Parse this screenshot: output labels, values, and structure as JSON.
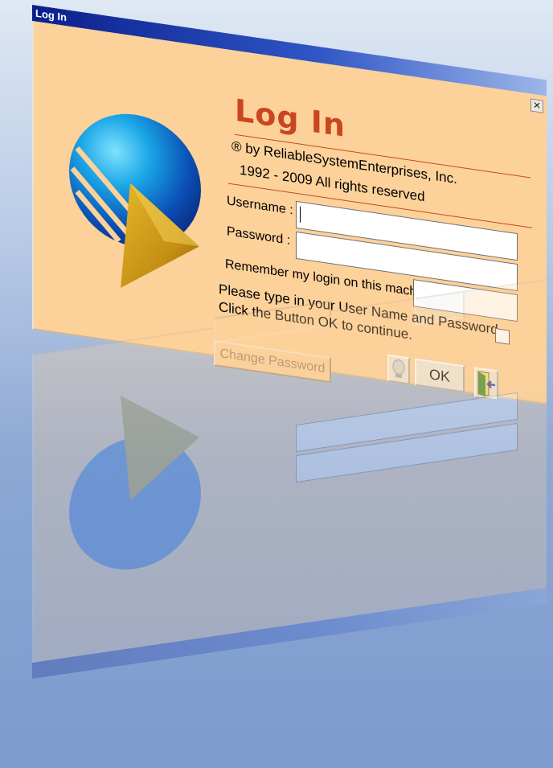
{
  "window": {
    "title": "Log In",
    "close_glyph": "×"
  },
  "dialog": {
    "heading": "Log In",
    "copyright_line1": "® by ReliableSystemEnterprises, Inc.",
    "copyright_line2": "1992 - 2009 All rights reserved",
    "username_label": "Username :",
    "username_value": "",
    "password_label": "Password :",
    "password_value": "",
    "remember_label": "Remember my login on this machine:",
    "remember_checked": false,
    "instructions_line1": "Please type in your User Name and Password.",
    "instructions_line2": "Click the Button OK to continue.",
    "change_password_label": "Change Password",
    "change_password_enabled": false,
    "ok_label": "OK"
  },
  "icons": {
    "logo": "sphere-with-arrow-logo",
    "help": "lightbulb-icon",
    "exit": "exit-door-icon"
  },
  "colors": {
    "panel_background": "#fdd19a",
    "heading_color": "#c9461f",
    "titlebar_start": "#0b1f8a",
    "titlebar_end": "#9db6e8"
  }
}
